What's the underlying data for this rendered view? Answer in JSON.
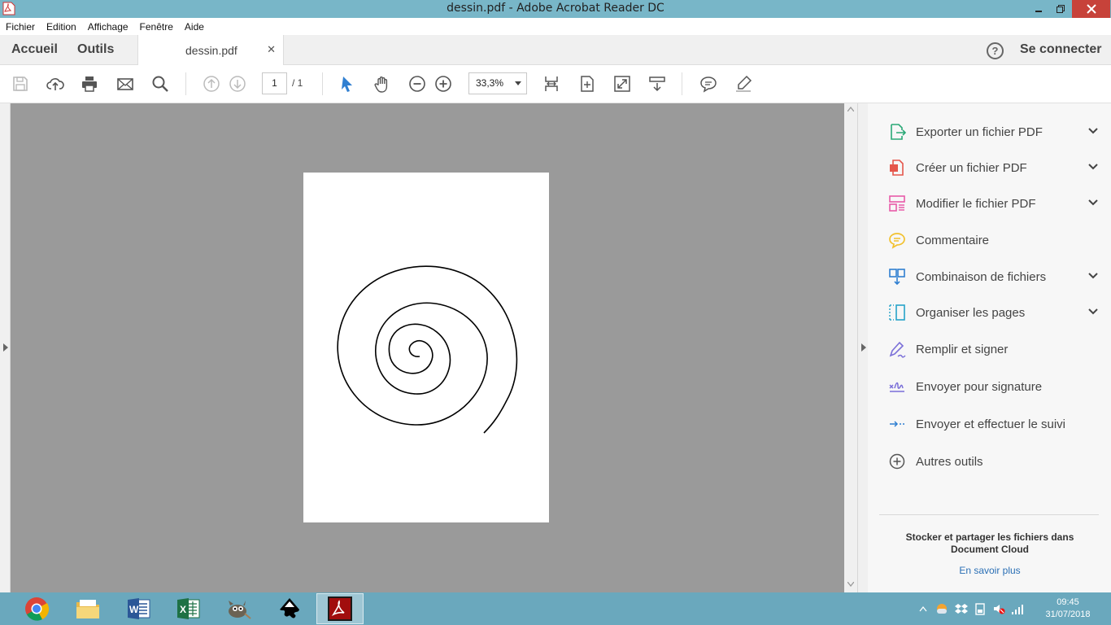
{
  "window": {
    "title": "dessin.pdf - Adobe Acrobat Reader DC"
  },
  "menu": {
    "items": [
      "Fichier",
      "Edition",
      "Affichage",
      "Fenêtre",
      "Aide"
    ]
  },
  "tabs": {
    "home": "Accueil",
    "tools": "Outils",
    "document": "dessin.pdf",
    "help_label": "?",
    "signin": "Se connecter"
  },
  "toolbar": {
    "page_current": "1",
    "page_total": "/ 1",
    "zoom": "33,3%"
  },
  "tools_pane": {
    "items": [
      {
        "label": "Exporter un fichier PDF",
        "icon": "export-pdf-icon",
        "color": "#2aa876",
        "expandable": true
      },
      {
        "label": "Créer un fichier PDF",
        "icon": "create-pdf-icon",
        "color": "#e5564b",
        "expandable": true
      },
      {
        "label": "Modifier le fichier PDF",
        "icon": "edit-pdf-icon",
        "color": "#e85ba8",
        "expandable": true
      },
      {
        "label": "Commentaire",
        "icon": "comment-icon",
        "color": "#f2c12e",
        "expandable": false
      },
      {
        "label": "Combinaison de fichiers",
        "icon": "combine-files-icon",
        "color": "#2f7fd1",
        "expandable": true
      },
      {
        "label": "Organiser les pages",
        "icon": "organize-pages-icon",
        "color": "#27a3c9",
        "expandable": true
      },
      {
        "label": "Remplir et signer",
        "icon": "fill-sign-icon",
        "color": "#7a6fd8",
        "expandable": false
      },
      {
        "label": "Envoyer pour signature",
        "icon": "send-signature-icon",
        "color": "#7a6fd8",
        "expandable": false
      },
      {
        "label": "Envoyer et effectuer le suivi",
        "icon": "send-track-icon",
        "color": "#2f7fd1",
        "expandable": false
      },
      {
        "label": "Autres outils",
        "icon": "more-tools-icon",
        "color": "#555555",
        "expandable": false
      }
    ],
    "cloud_text": "Stocker et partager les fichiers dans Document Cloud",
    "learn_more": "En savoir plus"
  },
  "taskbar": {
    "apps": [
      "chrome-icon",
      "file-explorer-icon",
      "word-icon",
      "excel-icon",
      "gimp-icon",
      "inkscape-icon",
      "acrobat-icon"
    ],
    "active": "acrobat-icon",
    "time": "09:45",
    "date": "31/07/2018"
  },
  "colors": {
    "titlebar": "#78b6c8",
    "taskbar": "#6aa8bd",
    "viewer_bg": "#9a9a9a",
    "accent": "#2f7fd1"
  }
}
